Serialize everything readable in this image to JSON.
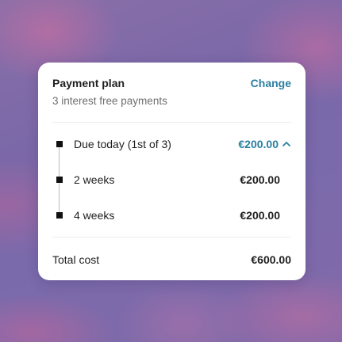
{
  "plan": {
    "title": "Payment plan",
    "subtitle": "3 interest free payments",
    "change_label": "Change"
  },
  "payments": [
    {
      "label": "Due today (1st of 3)",
      "amount": "€200.00",
      "highlighted": true
    },
    {
      "label": "2 weeks",
      "amount": "€200.00"
    },
    {
      "label": "4 weeks",
      "amount": "€200.00"
    }
  ],
  "total": {
    "label": "Total cost",
    "amount": "€600.00"
  },
  "icons": {
    "expand": "chevron-up-icon"
  },
  "colors": {
    "accent": "#2a7fa0",
    "text": "#1f1f1f",
    "muted": "#6e6e6e"
  }
}
